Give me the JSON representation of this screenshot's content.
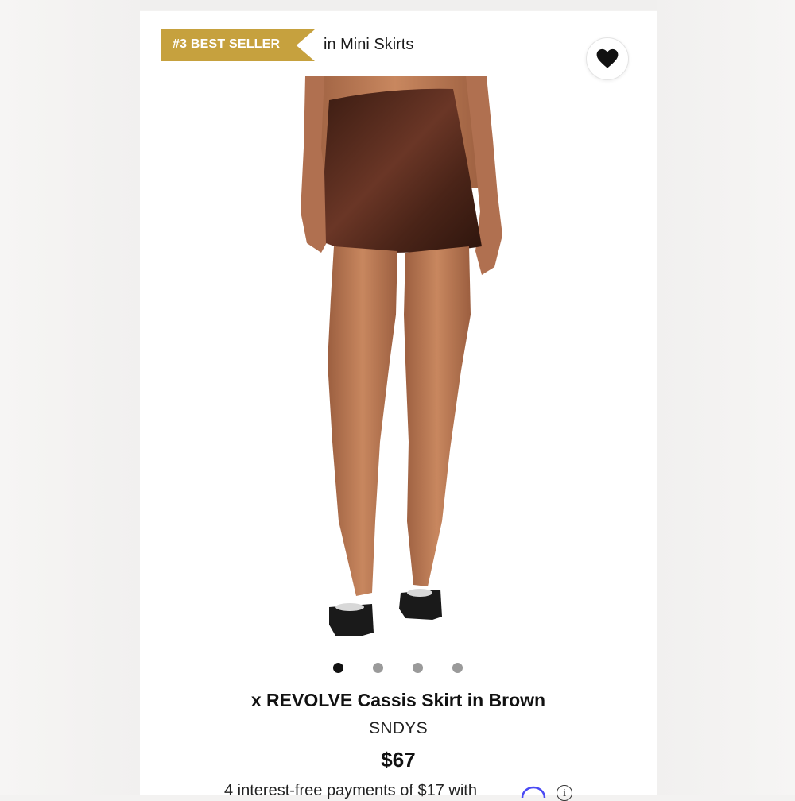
{
  "badge": {
    "rank_label": "#3 BEST SELLER",
    "category_text": "in Mini Skirts",
    "color": "#c6a13e"
  },
  "wishlist": {
    "icon": "heart-icon"
  },
  "gallery": {
    "image_count": 4,
    "active_index": 0
  },
  "product": {
    "title": "x REVOLVE Cassis Skirt in Brown",
    "brand": "SNDYS",
    "price": "$67",
    "installments_text": "4 interest-free payments of $17 with",
    "financing_icon": "affirm-logo",
    "info_icon": "info-icon"
  },
  "colors": {
    "skirt": "#4a2418",
    "skin": "#b57451"
  }
}
